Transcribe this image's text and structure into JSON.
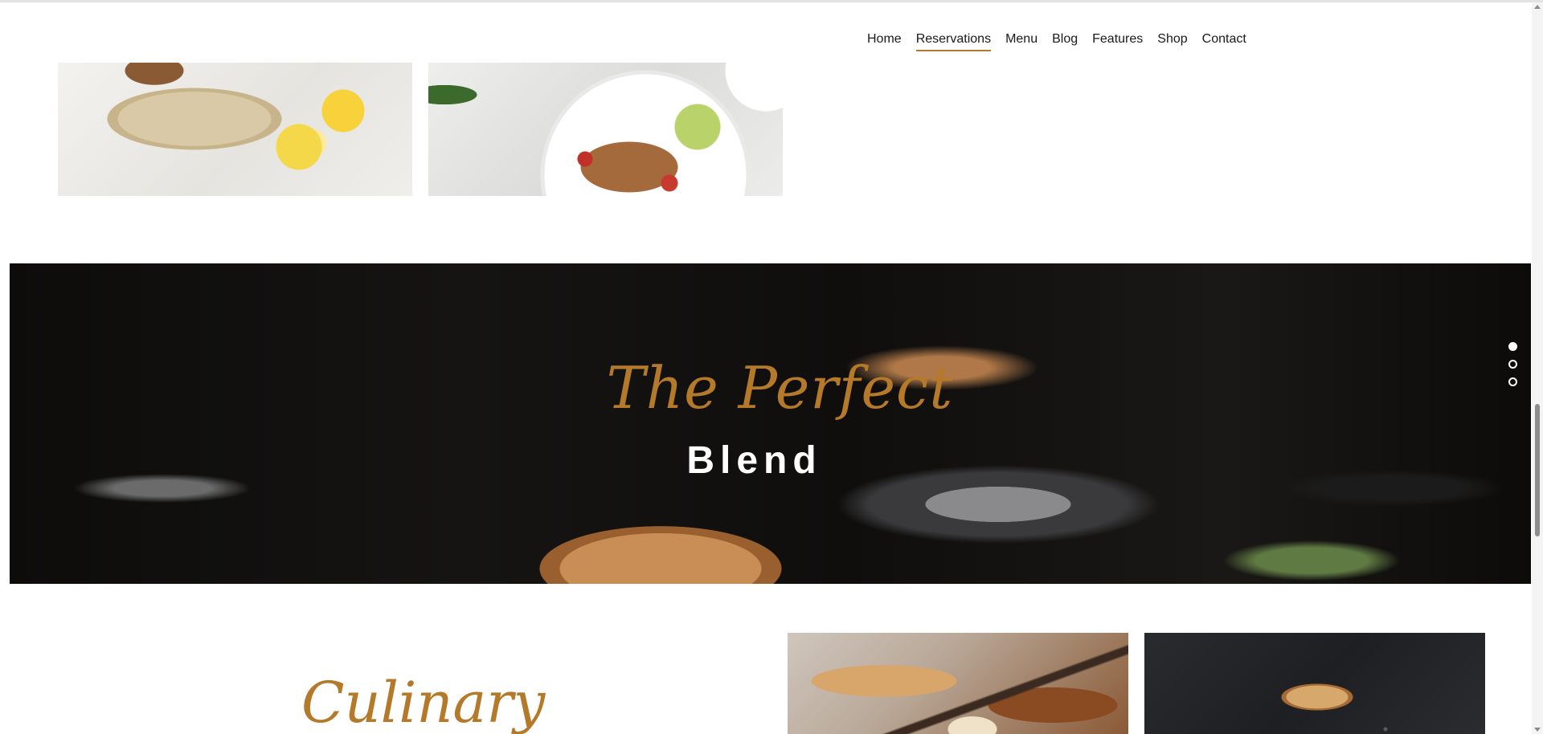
{
  "nav": {
    "items": [
      {
        "label": "Home",
        "active": false
      },
      {
        "label": "Reservations",
        "active": true
      },
      {
        "label": "Menu",
        "active": false
      },
      {
        "label": "Blog",
        "active": false
      },
      {
        "label": "Features",
        "active": false
      },
      {
        "label": "Shop",
        "active": false
      },
      {
        "label": "Contact",
        "active": false
      }
    ]
  },
  "hero": {
    "script_text": "The Perfect",
    "bold_text": "Blend",
    "slides_total": 3,
    "active_slide": 1
  },
  "section": {
    "script_text": "Culinary"
  },
  "colors": {
    "accent": "#b5792a",
    "text": "#1a1a1a",
    "hero_text": "#ffffff"
  }
}
